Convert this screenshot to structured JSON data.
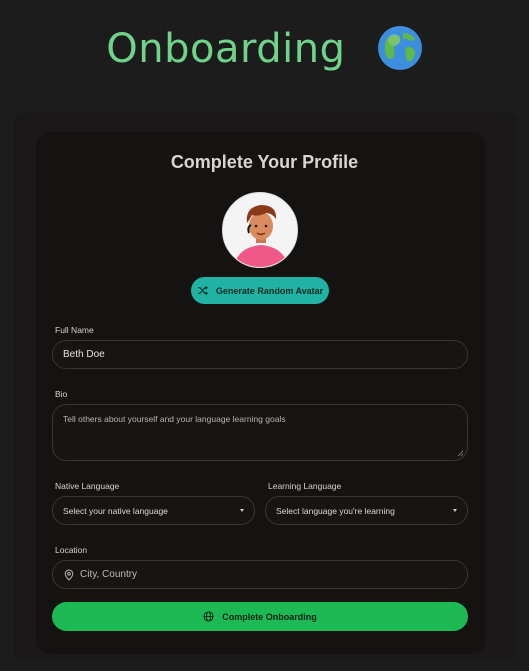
{
  "header": {
    "title": "Onboarding",
    "emoji_icon": "globe-europe-africa-icon"
  },
  "card": {
    "title": "Complete Your Profile",
    "avatar_icon": "avatar-illustration",
    "generate_avatar_label": "Generate Random Avatar",
    "generate_avatar_icon": "shuffle-icon"
  },
  "form": {
    "full_name": {
      "label": "Full Name",
      "value": "Beth Doe"
    },
    "bio": {
      "label": "Bio",
      "placeholder": "Tell others about yourself and your language learning goals"
    },
    "native_language": {
      "label": "Native Language",
      "selected": "Select your native language"
    },
    "learning_language": {
      "label": "Learning Language",
      "selected": "Select language you're learning"
    },
    "location": {
      "label": "Location",
      "placeholder": "City, Country",
      "icon": "map-pin-icon"
    },
    "submit_label": "Complete Onboarding",
    "submit_icon": "globe-icon"
  },
  "colors": {
    "accent_green": "#1db954",
    "title_green": "#6fd48a",
    "teal_button": "#20b3a3",
    "avatar_bg": "#f4f4f4",
    "background": "#1c1c1c"
  }
}
